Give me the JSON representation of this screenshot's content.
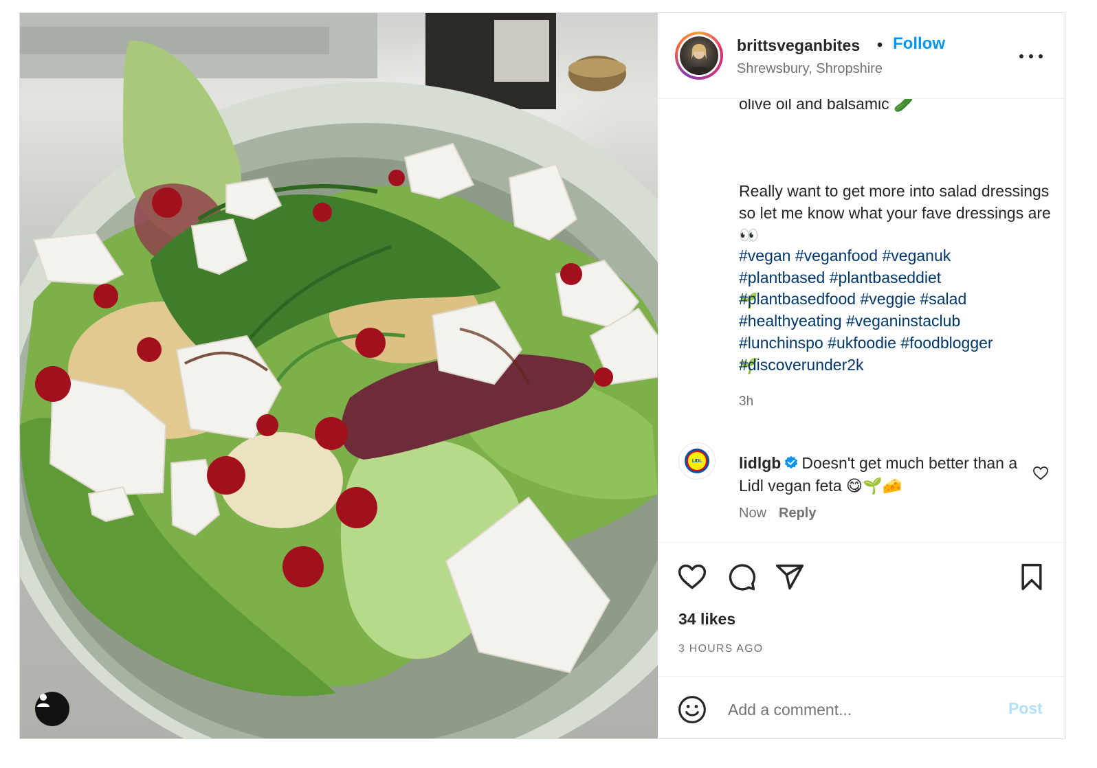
{
  "post": {
    "username": "brittsveganbites",
    "separator": "•",
    "follow_label": "Follow",
    "location": "Shrewsbury, Shropshire",
    "caption_top": "olive oil and balsamic 🥒",
    "caption_main": "Really want to get more into salad dressings so let me know what your fave dressings are 👀",
    "sprout_1": "🌱",
    "sprout_2": "🌱",
    "hashtags": [
      "#vegan",
      "#veganfood",
      "#veganuk",
      "#plantbased",
      "#plantbaseddiet",
      "#plantbasedfood",
      "#veggie",
      "#salad",
      "#healthyeating",
      "#veganinstaclub",
      "#lunchinspo",
      "#ukfoodie",
      "#foodblogger",
      "#discoverunder2k"
    ],
    "caption_time": "3h"
  },
  "comment": {
    "username": "lidlgb",
    "text": "Doesn't get much better than a Lidl vegan feta 😋🌱🧀",
    "time": "Now",
    "reply_label": "Reply",
    "avatar_text": "LIDL"
  },
  "actions": {
    "likes": "34 likes",
    "time_ago": "3 HOURS AGO"
  },
  "comment_box": {
    "placeholder": "Add a comment...",
    "post_label": "Post"
  },
  "colors": {
    "link_blue": "#0095f6",
    "hashtag_blue": "#00376b",
    "muted": "#737373",
    "verified": "#0095f6"
  },
  "icons": [
    "user-tag-icon",
    "more-options-icon",
    "verified-icon",
    "heart-icon",
    "comment-icon",
    "share-icon",
    "bookmark-icon",
    "emoji-icon"
  ]
}
